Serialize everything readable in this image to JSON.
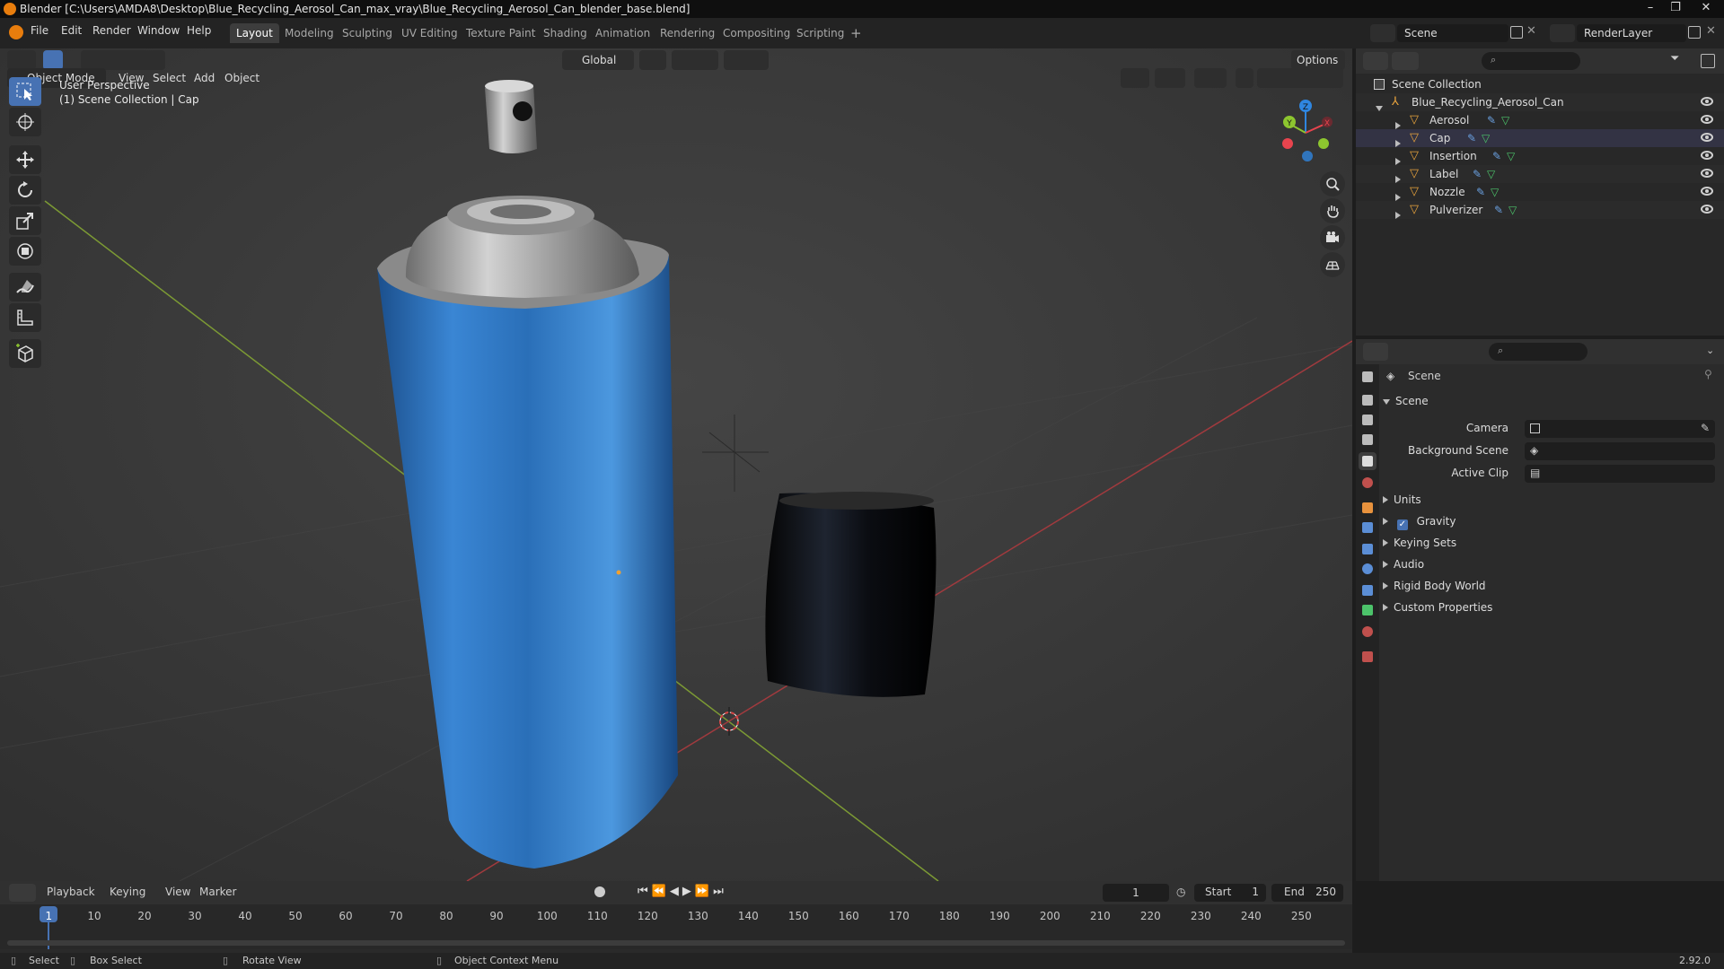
{
  "app": {
    "title": "Blender [C:\\Users\\AMDA8\\Desktop\\Blue_Recycling_Aerosol_Can_max_vray\\Blue_Recycling_Aerosol_Can_blender_base.blend]",
    "version": "2.92.0",
    "window_controls": [
      "–",
      "❐",
      "✕"
    ]
  },
  "menubar": {
    "menus": [
      "File",
      "Edit",
      "Render",
      "Window",
      "Help"
    ],
    "workspaces": [
      "Layout",
      "Modeling",
      "Sculpting",
      "UV Editing",
      "Texture Paint",
      "Shading",
      "Animation",
      "Rendering",
      "Compositing",
      "Scripting"
    ],
    "active_workspace": "Layout",
    "add_workspace": "+",
    "scene_field": "Scene",
    "render_layer_field": "RenderLayer"
  },
  "viewport": {
    "transform_orientation": "Global",
    "options_label": "Options",
    "mode": "Object Mode",
    "menus": [
      "View",
      "Select",
      "Add",
      "Object"
    ],
    "perspective_label": "User Perspective",
    "context_label": "(1) Scene Collection | Cap",
    "gizmo_axes": {
      "x": "X",
      "y": "Y",
      "z": "Z"
    },
    "colors": {
      "x_axis": "#e8444e",
      "y_axis": "#8dc62f",
      "z_axis": "#2f86e0",
      "accent": "#4772b3",
      "can_blue": "#2a6fb8"
    }
  },
  "outliner": {
    "root": "Scene Collection",
    "collection": "Blue_Recycling_Aerosol_Can",
    "objects": [
      "Aerosol",
      "Cap",
      "Insertion",
      "Label",
      "Nozzle",
      "Pulverizer"
    ]
  },
  "properties": {
    "header": "Scene",
    "panel_title": "Scene",
    "fields": [
      {
        "label": "Camera",
        "value": ""
      },
      {
        "label": "Background Scene",
        "value": ""
      },
      {
        "label": "Active Clip",
        "value": ""
      }
    ],
    "subpanels": [
      "Units",
      "Gravity",
      "Keying Sets",
      "Audio",
      "Rigid Body World",
      "Custom Properties"
    ],
    "gravity_checked": true
  },
  "timeline": {
    "menus": [
      "Playback",
      "Keying",
      "View",
      "Marker"
    ],
    "current_frame": "1",
    "start_label": "Start",
    "start_value": "1",
    "end_label": "End",
    "end_value": "250",
    "ruler": [
      "1",
      "10",
      "20",
      "30",
      "40",
      "50",
      "60",
      "70",
      "80",
      "90",
      "100",
      "110",
      "120",
      "130",
      "140",
      "150",
      "160",
      "170",
      "180",
      "190",
      "200",
      "210",
      "220",
      "230",
      "240",
      "250"
    ]
  },
  "statusbar": {
    "select": "Select",
    "box_select": "Box Select",
    "rotate_view": "Rotate View",
    "context_menu": "Object Context Menu"
  }
}
